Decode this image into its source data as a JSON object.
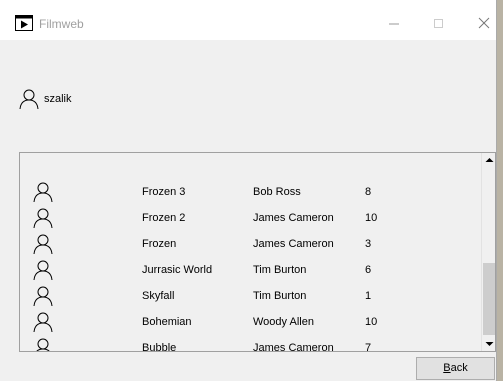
{
  "window": {
    "title": "Filmweb",
    "icon": "film-clapper-icon"
  },
  "user": {
    "name": "szalik",
    "icon": "user-outline-icon"
  },
  "movies": [
    {
      "title": "Frozen 3",
      "director": "Bob Ross",
      "rating": "8"
    },
    {
      "title": "Frozen 2",
      "director": "James Cameron",
      "rating": "10"
    },
    {
      "title": "Frozen",
      "director": "James Cameron",
      "rating": "3"
    },
    {
      "title": "Jurrasic World",
      "director": "Tim Burton",
      "rating": "6"
    },
    {
      "title": "Skyfall",
      "director": "Tim Burton",
      "rating": "1"
    },
    {
      "title": "Bohemian",
      "director": "Woody Allen",
      "rating": "10"
    },
    {
      "title": "Bubble",
      "director": "James Cameron",
      "rating": "7"
    }
  ],
  "buttons": {
    "back_accel": "B",
    "back_rest": "ack"
  }
}
